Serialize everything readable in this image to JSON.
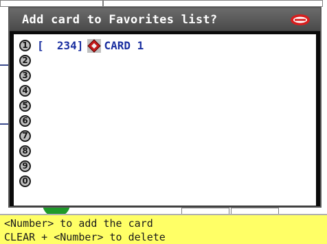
{
  "dialog": {
    "title": "Add card to Favorites list?",
    "brand_icon": "brand-logo-icon",
    "slots": [
      {
        "number": "1",
        "code": "[  234]",
        "card_icon": "card-icon",
        "card_name": "CARD 1"
      },
      {
        "number": "2",
        "code": "",
        "card_icon": "",
        "card_name": ""
      },
      {
        "number": "3",
        "code": "",
        "card_icon": "",
        "card_name": ""
      },
      {
        "number": "4",
        "code": "",
        "card_icon": "",
        "card_name": ""
      },
      {
        "number": "5",
        "code": "",
        "card_icon": "",
        "card_name": ""
      },
      {
        "number": "6",
        "code": "",
        "card_icon": "",
        "card_name": ""
      },
      {
        "number": "7",
        "code": "",
        "card_icon": "",
        "card_name": ""
      },
      {
        "number": "8",
        "code": "",
        "card_icon": "",
        "card_name": ""
      },
      {
        "number": "9",
        "code": "",
        "card_icon": "",
        "card_name": ""
      },
      {
        "number": "0",
        "code": "",
        "card_icon": "",
        "card_name": ""
      }
    ]
  },
  "info_bar": {
    "line1": "<Number> to add the card",
    "line2": "CLEAR + <Number> to delete"
  },
  "colors": {
    "list_text": "#1a2fa0",
    "info_bar_bg": "#ffff66",
    "title_bar": "#5a5a5a"
  }
}
